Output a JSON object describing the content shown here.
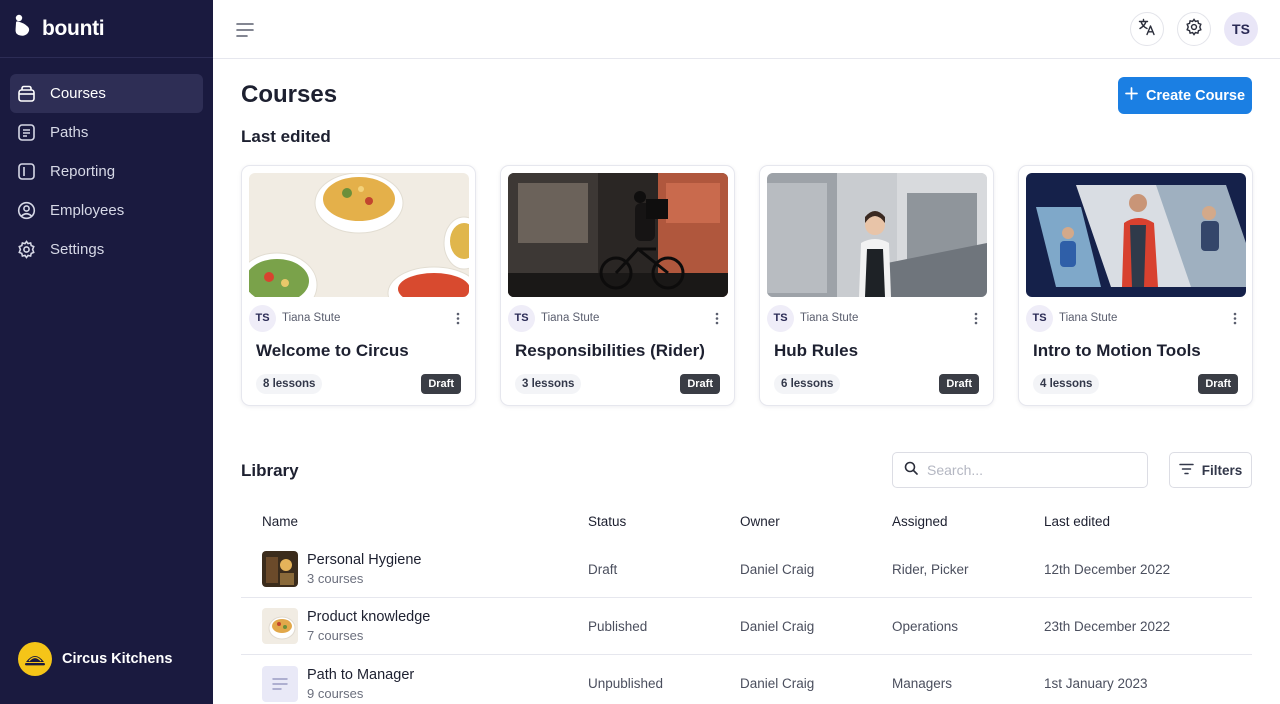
{
  "brand": {
    "name": "bounti"
  },
  "sidebar": {
    "items": [
      {
        "label": "Courses",
        "icon": "courses-icon",
        "active": true
      },
      {
        "label": "Paths",
        "icon": "paths-icon",
        "active": false
      },
      {
        "label": "Reporting",
        "icon": "reporting-icon",
        "active": false
      },
      {
        "label": "Employees",
        "icon": "employees-icon",
        "active": false
      },
      {
        "label": "Settings",
        "icon": "settings-icon",
        "active": false
      }
    ],
    "org_name": "Circus Kitchens"
  },
  "topbar": {
    "user_initials": "TS"
  },
  "page": {
    "title": "Courses",
    "create_label": "Create Course",
    "last_edited_title": "Last edited"
  },
  "cards": [
    {
      "owner_initials": "TS",
      "owner": "Tiana Stute",
      "title": "Welcome to Circus",
      "lessons": "8 lessons",
      "status": "Draft"
    },
    {
      "owner_initials": "TS",
      "owner": "Tiana Stute",
      "title": "Responsibilities (Rider)",
      "lessons": "3 lessons",
      "status": "Draft"
    },
    {
      "owner_initials": "TS",
      "owner": "Tiana Stute",
      "title": "Hub Rules",
      "lessons": "6 lessons",
      "status": "Draft"
    },
    {
      "owner_initials": "TS",
      "owner": "Tiana Stute",
      "title": "Intro to Motion Tools",
      "lessons": "4 lessons",
      "status": "Draft"
    }
  ],
  "library": {
    "title": "Library",
    "search_placeholder": "Search...",
    "filters_label": "Filters",
    "columns": [
      "Name",
      "Status",
      "Owner",
      "Assigned",
      "Last edited"
    ],
    "rows": [
      {
        "name": "Personal Hygiene",
        "sub": "3 courses",
        "status": "Draft",
        "owner": "Daniel Craig",
        "assigned": "Rider, Picker",
        "last_edited": "12th December 2022"
      },
      {
        "name": "Product knowledge",
        "sub": "7 courses",
        "status": "Published",
        "owner": "Daniel Craig",
        "assigned": "Operations",
        "last_edited": "23th December 2022"
      },
      {
        "name": "Path to Manager",
        "sub": "9 courses",
        "status": "Unpublished",
        "owner": "Daniel Craig",
        "assigned": "Managers",
        "last_edited": "1st January 2023"
      }
    ]
  },
  "colors": {
    "sidebar_bg": "#1a1a3f",
    "accent": "#1b7fe3",
    "draft_badge": "#3a3d45",
    "org_logo": "#f5c518"
  }
}
